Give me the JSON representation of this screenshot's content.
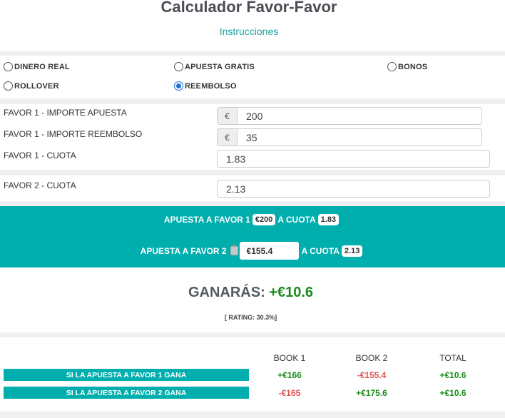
{
  "header": {
    "title": "Calculador Favor-Favor",
    "instructions_link": "Instrucciones"
  },
  "bet_types": [
    {
      "label": "DINERO REAL",
      "checked": false
    },
    {
      "label": "APUESTA GRATIS",
      "checked": false
    },
    {
      "label": "BONOS",
      "checked": false
    },
    {
      "label": "ROLLOVER",
      "checked": false
    },
    {
      "label": "REEMBOLSO",
      "checked": true
    }
  ],
  "inputs": {
    "currency_symbol": "€",
    "favor1_amount": {
      "label": "FAVOR 1 - IMPORTE APUESTA",
      "value": "200"
    },
    "favor1_refund": {
      "label": "FAVOR 1 - IMPORTE REEMBOLSO",
      "value": "35"
    },
    "favor1_odds": {
      "label": "FAVOR 1 - CUOTA",
      "value": "1.83"
    },
    "favor2_odds": {
      "label": "FAVOR 2 - CUOTA",
      "value": "2.13"
    }
  },
  "summary": {
    "bet1_label": "APUESTA A FAVOR 1",
    "bet1_amount": "€200",
    "bet1_odds_label": "A CUOTA",
    "bet1_odds": "1.83",
    "bet2_label": "APUESTA A FAVOR 2",
    "bet2_amount": "€155.4",
    "bet2_odds_label": "A CUOTA",
    "bet2_odds": "2.13"
  },
  "result": {
    "label": "GANARÁS:",
    "value": "+€10.6",
    "rating": "[ RATING: 30.3%]"
  },
  "outcomes": {
    "headers": [
      "BOOK 1",
      "BOOK 2",
      "TOTAL"
    ],
    "rows": [
      {
        "scenario": "SI LA APUESTA A FAVOR 1 GANA",
        "book1": "+€166",
        "book2": "-€155.4",
        "total": "+€10.6"
      },
      {
        "scenario": "SI LA APUESTA A FAVOR 2 GANA",
        "book1": "-€165",
        "book2": "+€175.6",
        "total": "+€10.6"
      }
    ]
  },
  "colors": {
    "teal": "#00aeae",
    "positive": "#1c8c1c",
    "negative": "#e05252",
    "link": "#1aa3a3"
  }
}
